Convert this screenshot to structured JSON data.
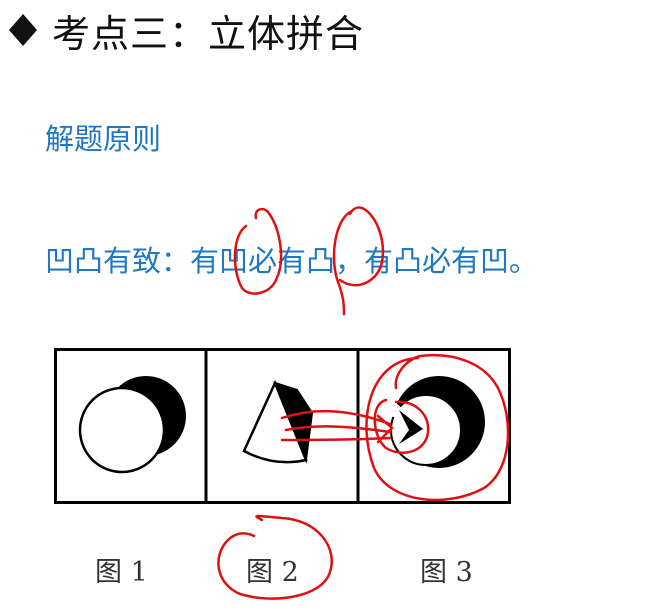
{
  "title": "考点三：立体拼合",
  "section_label": "解题原则",
  "principle": "凹凸有致：有凹必有凸，有凸必有凹。",
  "figures": {
    "captions": [
      "图 1",
      "图 2",
      "图 3"
    ]
  },
  "colors": {
    "title": "#111111",
    "accent_blue": "#1f78c1",
    "annotation_red": "#e01010",
    "figure_ink": "#000000"
  },
  "icons": {
    "bullet": "black-diamond-icon"
  }
}
